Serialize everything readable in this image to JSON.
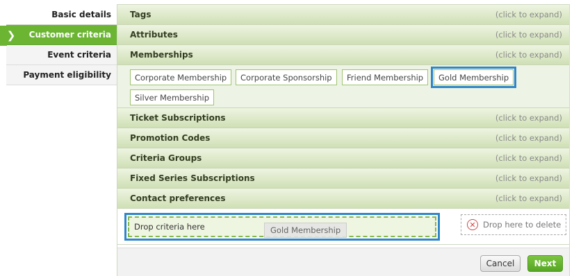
{
  "sidebar": {
    "items": [
      {
        "label": "Basic details"
      },
      {
        "label": "Customer criteria"
      },
      {
        "label": "Event criteria"
      },
      {
        "label": "Payment eligibility"
      }
    ],
    "active_chevron": "❯"
  },
  "sections": {
    "expand_hint": "(click to expand)",
    "tags": "Tags",
    "attributes": "Attributes",
    "memberships": "Memberships",
    "ticket_subscriptions": "Ticket Subscriptions",
    "promotion_codes": "Promotion Codes",
    "criteria_groups": "Criteria Groups",
    "fixed_series_subscriptions": "Fixed Series Subscriptions",
    "contact_preferences": "Contact preferences"
  },
  "memberships": {
    "chips": [
      "Corporate Membership",
      "Corporate Sponsorship",
      "Friend Membership",
      "Gold Membership",
      "Silver Membership"
    ]
  },
  "drop": {
    "placeholder": "Drop criteria here",
    "dragging_item": "Gold Membership",
    "delete_label": "Drop here to delete",
    "delete_icon": "x-circle-icon"
  },
  "footer": {
    "cancel_label": "Cancel",
    "next_label": "Next"
  },
  "colors": {
    "accent_green": "#6bb533",
    "highlight_blue": "#2e86c8"
  }
}
